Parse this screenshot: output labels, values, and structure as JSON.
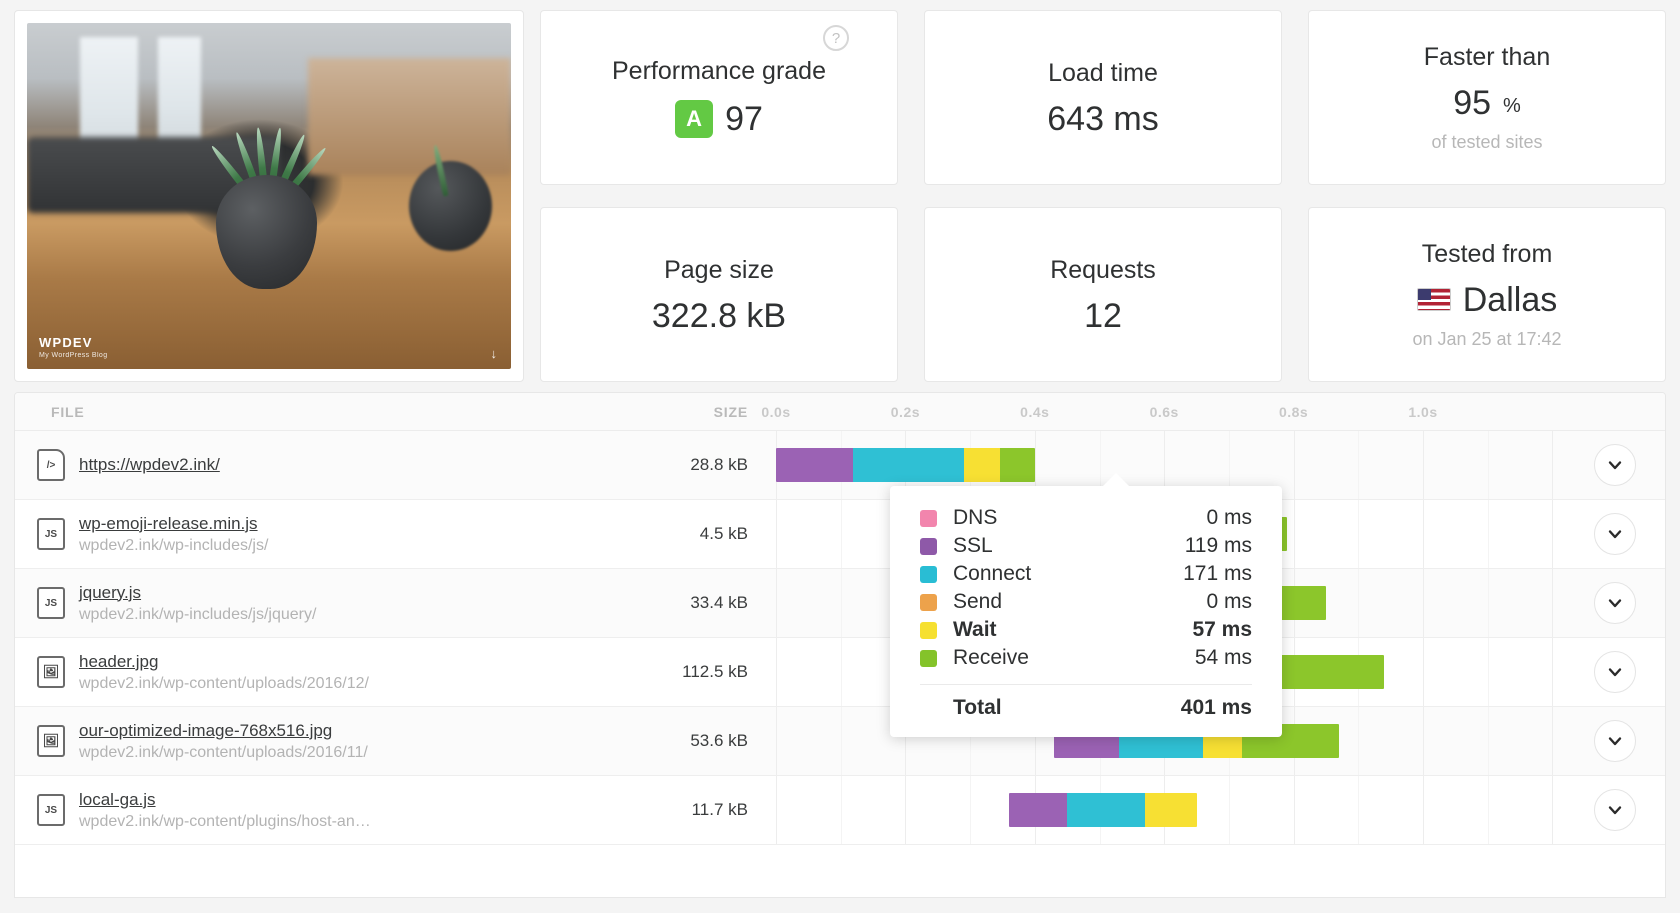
{
  "thumbnail": {
    "watermark_title": "WPDEV",
    "watermark_subtitle": "My WordPress Blog",
    "scroll_arrow": "↓"
  },
  "stats": {
    "performance": {
      "title": "Performance grade",
      "grade": "A",
      "value": "97",
      "help_icon": "?",
      "grade_color": "#63c944"
    },
    "load_time": {
      "title": "Load time",
      "value": "643 ms"
    },
    "faster_than": {
      "title": "Faster than",
      "value": "95",
      "unit": "%",
      "sub": "of tested sites"
    },
    "page_size": {
      "title": "Page size",
      "value": "322.8 kB"
    },
    "requests": {
      "title": "Requests",
      "value": "12"
    },
    "tested_from": {
      "title": "Tested from",
      "city": "Dallas",
      "flag": "us-flag",
      "sub": "on Jan 25 at 17:42"
    }
  },
  "table": {
    "headers": {
      "file": "FILE",
      "size": "SIZE"
    },
    "axis_ticks": [
      "0.0s",
      "0.2s",
      "0.4s",
      "0.6s",
      "0.8s",
      "1.0s"
    ],
    "expand_icon": "chevron-down-icon",
    "rows": [
      {
        "icon": "html-file-icon",
        "icon_label": "/>",
        "name": "https://wpdev2.ink/",
        "path": "",
        "size": "28.8 kB",
        "bar": {
          "start_s": 0.0,
          "segments": [
            {
              "phase": "SSL",
              "duration_s": 0.119
            },
            {
              "phase": "Connect",
              "duration_s": 0.171
            },
            {
              "phase": "Wait",
              "duration_s": 0.057
            },
            {
              "phase": "Receive",
              "duration_s": 0.054
            }
          ]
        }
      },
      {
        "icon": "js-file-icon",
        "icon_label": "JS",
        "name": "wp-emoji-release.min.js",
        "path": "wpdev2.ink/wp-includes/js/",
        "size": "4.5 kB",
        "bar": {
          "start_s": 0.43,
          "segments": [
            {
              "phase": "SSL",
              "duration_s": 0.1
            },
            {
              "phase": "Connect",
              "duration_s": 0.13
            },
            {
              "phase": "Wait",
              "duration_s": 0.06
            },
            {
              "phase": "Receive",
              "duration_s": 0.07
            }
          ]
        }
      },
      {
        "icon": "js-file-icon",
        "icon_label": "JS",
        "name": "jquery.js",
        "path": "wpdev2.ink/wp-includes/js/jquery/",
        "size": "33.4 kB",
        "bar": {
          "start_s": 0.43,
          "segments": [
            {
              "phase": "SSL",
              "duration_s": 0.1
            },
            {
              "phase": "Connect",
              "duration_s": 0.13
            },
            {
              "phase": "Wait",
              "duration_s": 0.06
            },
            {
              "phase": "Receive",
              "duration_s": 0.13
            }
          ]
        }
      },
      {
        "icon": "image-file-icon",
        "icon_label": "🖼",
        "name": "header.jpg",
        "path": "wpdev2.ink/wp-content/uploads/2016/12/",
        "size": "112.5 kB",
        "bar": {
          "start_s": 0.43,
          "segments": [
            {
              "phase": "SSL",
              "duration_s": 0.1
            },
            {
              "phase": "Connect",
              "duration_s": 0.13
            },
            {
              "phase": "Wait",
              "duration_s": 0.06
            },
            {
              "phase": "Receive",
              "duration_s": 0.22
            }
          ]
        }
      },
      {
        "icon": "image-file-icon",
        "icon_label": "🖼",
        "name": "our-optimized-image-768x516.jpg",
        "path": "wpdev2.ink/wp-content/uploads/2016/11/",
        "size": "53.6 kB",
        "bar": {
          "start_s": 0.43,
          "segments": [
            {
              "phase": "SSL",
              "duration_s": 0.1
            },
            {
              "phase": "Connect",
              "duration_s": 0.13
            },
            {
              "phase": "Wait",
              "duration_s": 0.06
            },
            {
              "phase": "Receive",
              "duration_s": 0.15
            }
          ]
        }
      },
      {
        "icon": "js-file-icon",
        "icon_label": "JS",
        "name": "local-ga.js",
        "path": "wpdev2.ink/wp-content/plugins/host-an…",
        "size": "11.7 kB",
        "bar": {
          "start_s": 0.36,
          "segments": [
            {
              "phase": "SSL",
              "duration_s": 0.09
            },
            {
              "phase": "Connect",
              "duration_s": 0.12
            },
            {
              "phase": "Wait",
              "duration_s": 0.08
            }
          ]
        }
      }
    ]
  },
  "tooltip": {
    "rows": [
      {
        "label": "DNS",
        "value": "0 ms",
        "color": "#f285ad",
        "bold": false
      },
      {
        "label": "SSL",
        "value": "119 ms",
        "color": "#8e59a8",
        "bold": false
      },
      {
        "label": "Connect",
        "value": "171 ms",
        "color": "#29bdd4",
        "bold": false
      },
      {
        "label": "Send",
        "value": "0 ms",
        "color": "#eda24b",
        "bold": false
      },
      {
        "label": "Wait",
        "value": "57 ms",
        "color": "#f6e030",
        "bold": true
      },
      {
        "label": "Receive",
        "value": "54 ms",
        "color": "#84c32a",
        "bold": false
      }
    ],
    "total_label": "Total",
    "total_value": "401 ms"
  },
  "phase_colors": {
    "DNS": "#f285ad",
    "SSL": "#9b62b4",
    "Connect": "#2fc0d4",
    "Send": "#eda24b",
    "Wait": "#f7e033",
    "Receive": "#8cc62b"
  },
  "timeline": {
    "min_s": 0.0,
    "max_s": 1.15,
    "pixels_per_second": 647
  }
}
